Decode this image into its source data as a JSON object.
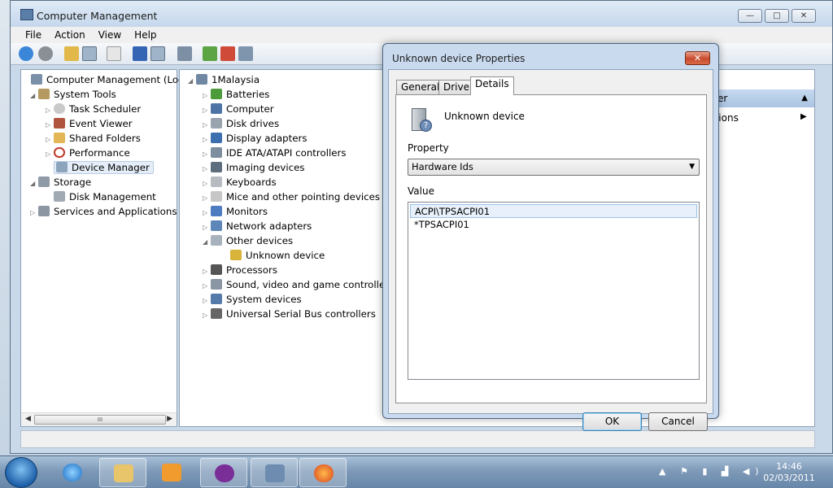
{
  "window": {
    "title": "Computer Management",
    "min": "—",
    "max": "□",
    "close": "✕"
  },
  "menu": [
    "File",
    "Action",
    "View",
    "Help"
  ],
  "left_tree": {
    "root": "Computer Management (Local",
    "system_tools": "System Tools",
    "task_scheduler": "Task Scheduler",
    "event_viewer": "Event Viewer",
    "shared_folders": "Shared Folders",
    "performance": "Performance",
    "device_manager": "Device Manager",
    "storage": "Storage",
    "disk_management": "Disk Management",
    "services": "Services and Applications",
    "scroll_grip": "III"
  },
  "device_tree": {
    "root": "1Malaysia",
    "items": [
      "Batteries",
      "Computer",
      "Disk drives",
      "Display adapters",
      "IDE ATA/ATAPI controllers",
      "Imaging devices",
      "Keyboards",
      "Mice and other pointing devices",
      "Monitors",
      "Network adapters",
      "Other devices",
      "Unknown device",
      "Processors",
      "Sound, video and game controllers",
      "System devices",
      "Universal Serial Bus controllers"
    ]
  },
  "actions": {
    "header": "ager",
    "item": "ctions"
  },
  "dialog": {
    "title": "Unknown device Properties",
    "tabs": [
      "General",
      "Driver",
      "Details"
    ],
    "device_name": "Unknown device",
    "property_label": "Property",
    "property_value": "Hardware Ids",
    "value_label": "Value",
    "values": [
      "ACPI\\TPSACPI01",
      "*TPSACPI01"
    ],
    "ok": "OK",
    "cancel": "Cancel"
  },
  "taskbar": {
    "time": "14:46",
    "date": "02/03/2011"
  }
}
